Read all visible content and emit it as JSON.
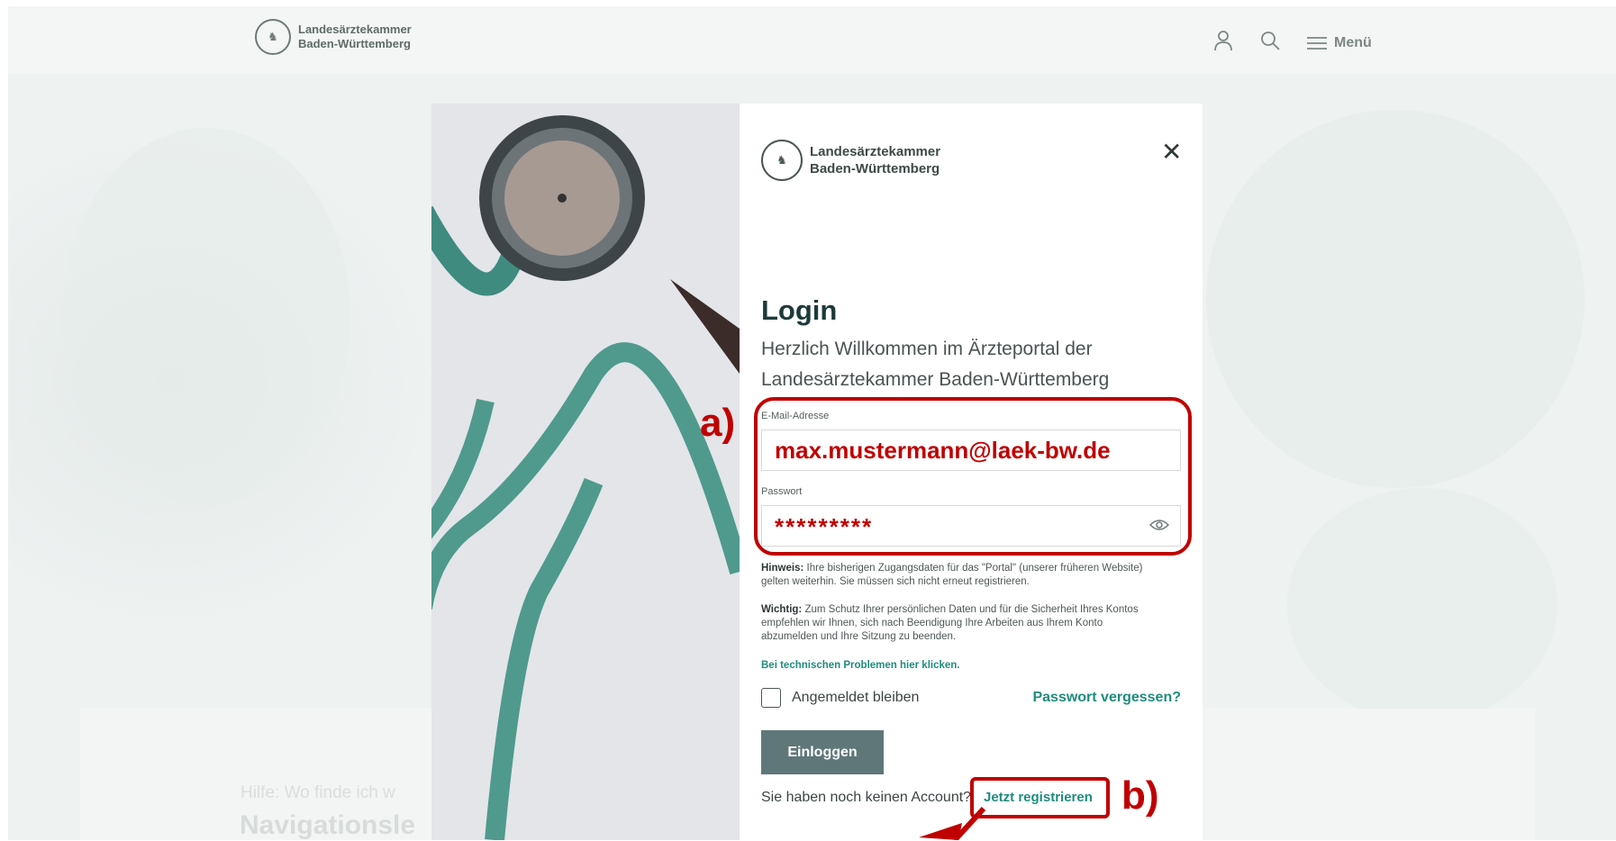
{
  "site": {
    "logo_line1": "Landesärztekammer",
    "logo_line2": "Baden-Württemberg",
    "menu_label": "Menü"
  },
  "background": {
    "help_text": "Hilfe: Wo finde ich w",
    "nav_heading": "Navigationsle"
  },
  "modal": {
    "logo_line1": "Landesärztekammer",
    "logo_line2": "Baden-Württemberg",
    "title": "Login",
    "welcome": "Herzlich Willkommen im Ärzteportal der Landesärztekammer Baden-Württemberg",
    "email_label": "E-Mail-Adresse",
    "email_value": "max.mustermann@laek-bw.de",
    "password_label": "Passwort",
    "password_value": "*********",
    "hint_label": "Hinweis:",
    "hint_text": "Ihre bisherigen Zugangsdaten für das \"Portal\" (unserer früheren Website) gelten weiterhin. Sie müssen sich nicht erneut registrieren.",
    "important_label": "Wichtig:",
    "important_text": "Zum Schutz Ihrer persönlichen Daten und für die Sicherheit Ihres Kontos empfehlen wir Ihnen, sich nach Beendigung Ihre Arbeiten aus Ihrem Konto abzumelden und Ihre Sitzung zu beenden.",
    "tech_link": "Bei technischen Problemen hier klicken.",
    "remember_label": "Angemeldet bleiben",
    "forgot_label": "Passwort vergessen?",
    "login_button": "Einloggen",
    "no_account_text": "Sie haben noch keinen Account?",
    "register_link": "Jetzt registrieren"
  },
  "annotations": {
    "label_a": "a)",
    "label_b": "b)"
  },
  "colors": {
    "accent": "#1f8c7c",
    "annotation_red": "#c00000",
    "login_button": "#5f7779"
  }
}
